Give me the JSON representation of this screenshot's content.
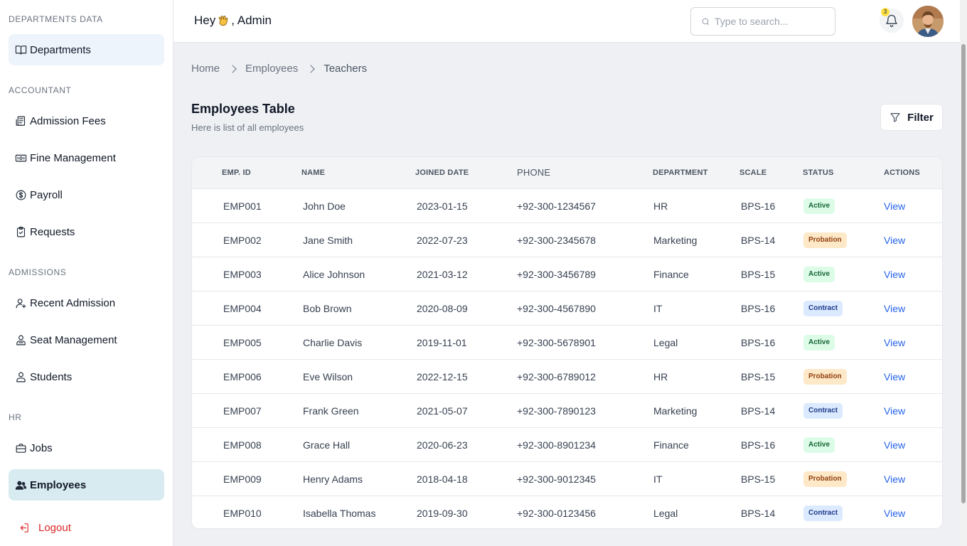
{
  "sidebar": {
    "sections": {
      "departments_data": "DEPARTMENTS DATA",
      "accountant": "ACCOUNTANT",
      "admissions": "ADMISSIONS",
      "hr": "HR"
    },
    "items": {
      "departments": "Departments",
      "admission_fees": "Admission Fees",
      "fine_management": "Fine Management",
      "payroll": "Payroll",
      "requests": "Requests",
      "recent_admission": "Recent Admission",
      "seat_management": "Seat Management",
      "students": "Students",
      "jobs": "Jobs",
      "employees": "Employees",
      "logout": "Logout"
    }
  },
  "header": {
    "greet_prefix": "Hey",
    "greet_name": ", Admin",
    "search_placeholder": "Type to search...",
    "notification_count": "3"
  },
  "breadcrumb": [
    "Home",
    "Employees",
    "Teachers"
  ],
  "page": {
    "title": "Employees Table",
    "subtitle": "Here is list of all employees",
    "filter_label": "Filter"
  },
  "table": {
    "headers": {
      "emp_id": "EMP. ID",
      "name": "NAME",
      "joined": "JOINED DATE",
      "phone": "PHONE",
      "department": "DEPARTMENT",
      "scale": "SCALE",
      "status": "STATUS",
      "actions": "ACTIONS"
    },
    "action_label": "View",
    "rows": [
      {
        "id": "EMP001",
        "name": "John Doe",
        "joined": "2023-01-15",
        "phone": "+92-300-1234567",
        "department": "HR",
        "scale": "BPS-16",
        "status": "Active"
      },
      {
        "id": "EMP002",
        "name": "Jane Smith",
        "joined": "2022-07-23",
        "phone": "+92-300-2345678",
        "department": "Marketing",
        "scale": "BPS-14",
        "status": "Probation"
      },
      {
        "id": "EMP003",
        "name": "Alice Johnson",
        "joined": "2021-03-12",
        "phone": "+92-300-3456789",
        "department": "Finance",
        "scale": "BPS-15",
        "status": "Active"
      },
      {
        "id": "EMP004",
        "name": "Bob Brown",
        "joined": "2020-08-09",
        "phone": "+92-300-4567890",
        "department": "IT",
        "scale": "BPS-16",
        "status": "Contract"
      },
      {
        "id": "EMP005",
        "name": "Charlie Davis",
        "joined": "2019-11-01",
        "phone": "+92-300-5678901",
        "department": "Legal",
        "scale": "BPS-16",
        "status": "Active"
      },
      {
        "id": "EMP006",
        "name": "Eve Wilson",
        "joined": "2022-12-15",
        "phone": "+92-300-6789012",
        "department": "HR",
        "scale": "BPS-15",
        "status": "Probation"
      },
      {
        "id": "EMP007",
        "name": "Frank Green",
        "joined": "2021-05-07",
        "phone": "+92-300-7890123",
        "department": "Marketing",
        "scale": "BPS-14",
        "status": "Contract"
      },
      {
        "id": "EMP008",
        "name": "Grace Hall",
        "joined": "2020-06-23",
        "phone": "+92-300-8901234",
        "department": "Finance",
        "scale": "BPS-16",
        "status": "Active"
      },
      {
        "id": "EMP009",
        "name": "Henry Adams",
        "joined": "2018-04-18",
        "phone": "+92-300-9012345",
        "department": "IT",
        "scale": "BPS-15",
        "status": "Probation"
      },
      {
        "id": "EMP010",
        "name": "Isabella Thomas",
        "joined": "2019-09-30",
        "phone": "+92-300-0123456",
        "department": "Legal",
        "scale": "BPS-14",
        "status": "Contract"
      }
    ]
  }
}
